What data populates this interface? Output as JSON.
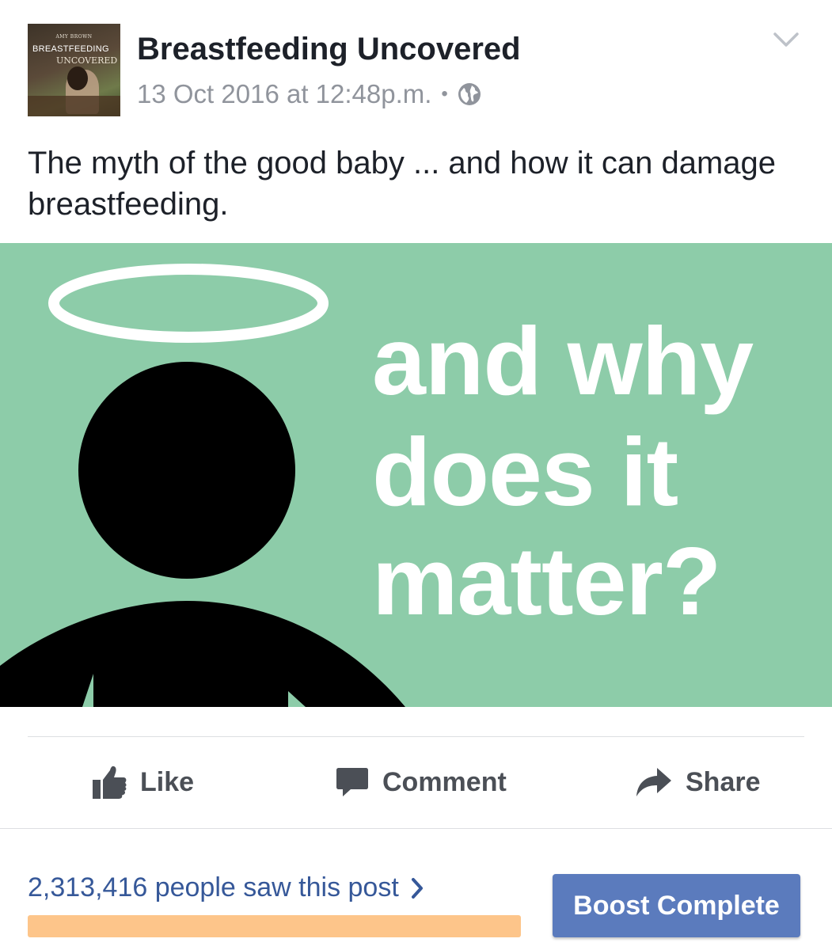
{
  "post": {
    "page_name": "Breastfeeding Uncovered",
    "timestamp": "13 Oct 2016 at 12:48p.m.",
    "separator": "•",
    "privacy_icon": "globe-icon",
    "menu_icon": "chevron-down-icon",
    "text": "The myth of the good baby ... and how it can damage breastfeeding."
  },
  "avatar": {
    "author": "AMY BROWN",
    "title_line1": "BREASTFEEDING",
    "title_line2": "UNCOVERED"
  },
  "hero": {
    "line1": "and why",
    "line2": "does it",
    "line3": "matter?",
    "background": "#8dcca9"
  },
  "actions": {
    "like": "Like",
    "comment": "Comment",
    "share": "Share"
  },
  "insights": {
    "reach_text": "2,313,416 people saw this post",
    "progress_fraction": 1.0,
    "boost_label": "Boost Complete"
  },
  "colors": {
    "link_blue": "#365899",
    "boost_button": "#5b7bbd",
    "progress": "#fdc58a",
    "muted_text": "#90949c"
  }
}
